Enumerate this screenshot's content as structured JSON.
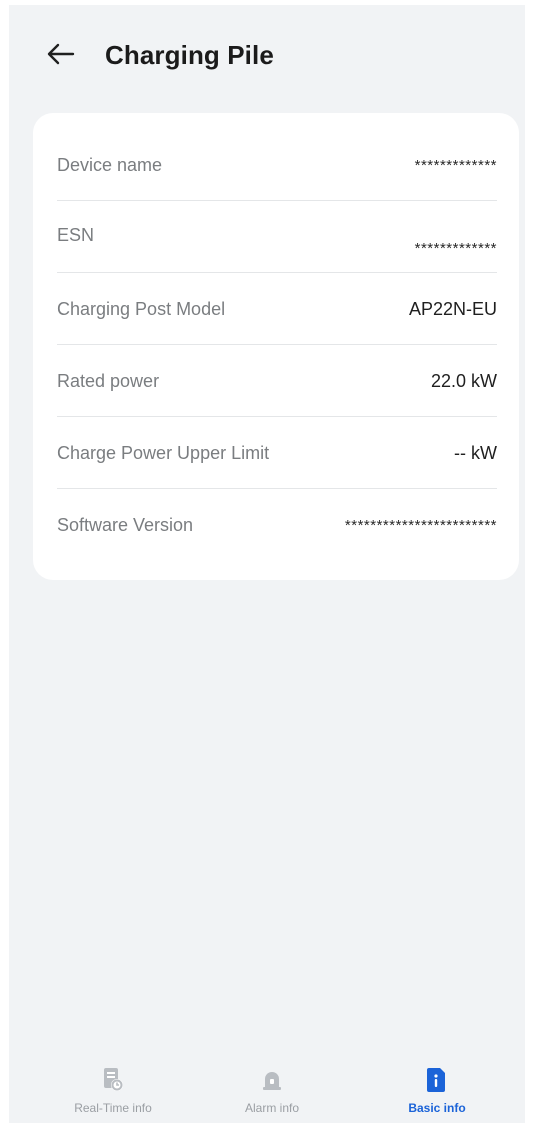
{
  "header": {
    "title": "Charging Pile"
  },
  "info_rows": [
    {
      "label": "Device name",
      "value": "*************"
    },
    {
      "label": "ESN",
      "value": "*************"
    },
    {
      "label": "Charging Post Model",
      "value": "AP22N-EU"
    },
    {
      "label": "Rated power",
      "value": "22.0 kW"
    },
    {
      "label": "Charge Power Upper Limit",
      "value": "-- kW"
    },
    {
      "label": "Software Version",
      "value": "************************"
    }
  ],
  "tabs": [
    {
      "label": "Real-Time info",
      "icon": "realtime-icon",
      "active": false
    },
    {
      "label": "Alarm info",
      "icon": "alarm-icon",
      "active": false
    },
    {
      "label": "Basic info",
      "icon": "info-icon",
      "active": true
    }
  ],
  "colors": {
    "accent": "#1b63d8",
    "background": "#f1f3f5",
    "card": "#ffffff",
    "inactive": "#9a9ea3"
  }
}
